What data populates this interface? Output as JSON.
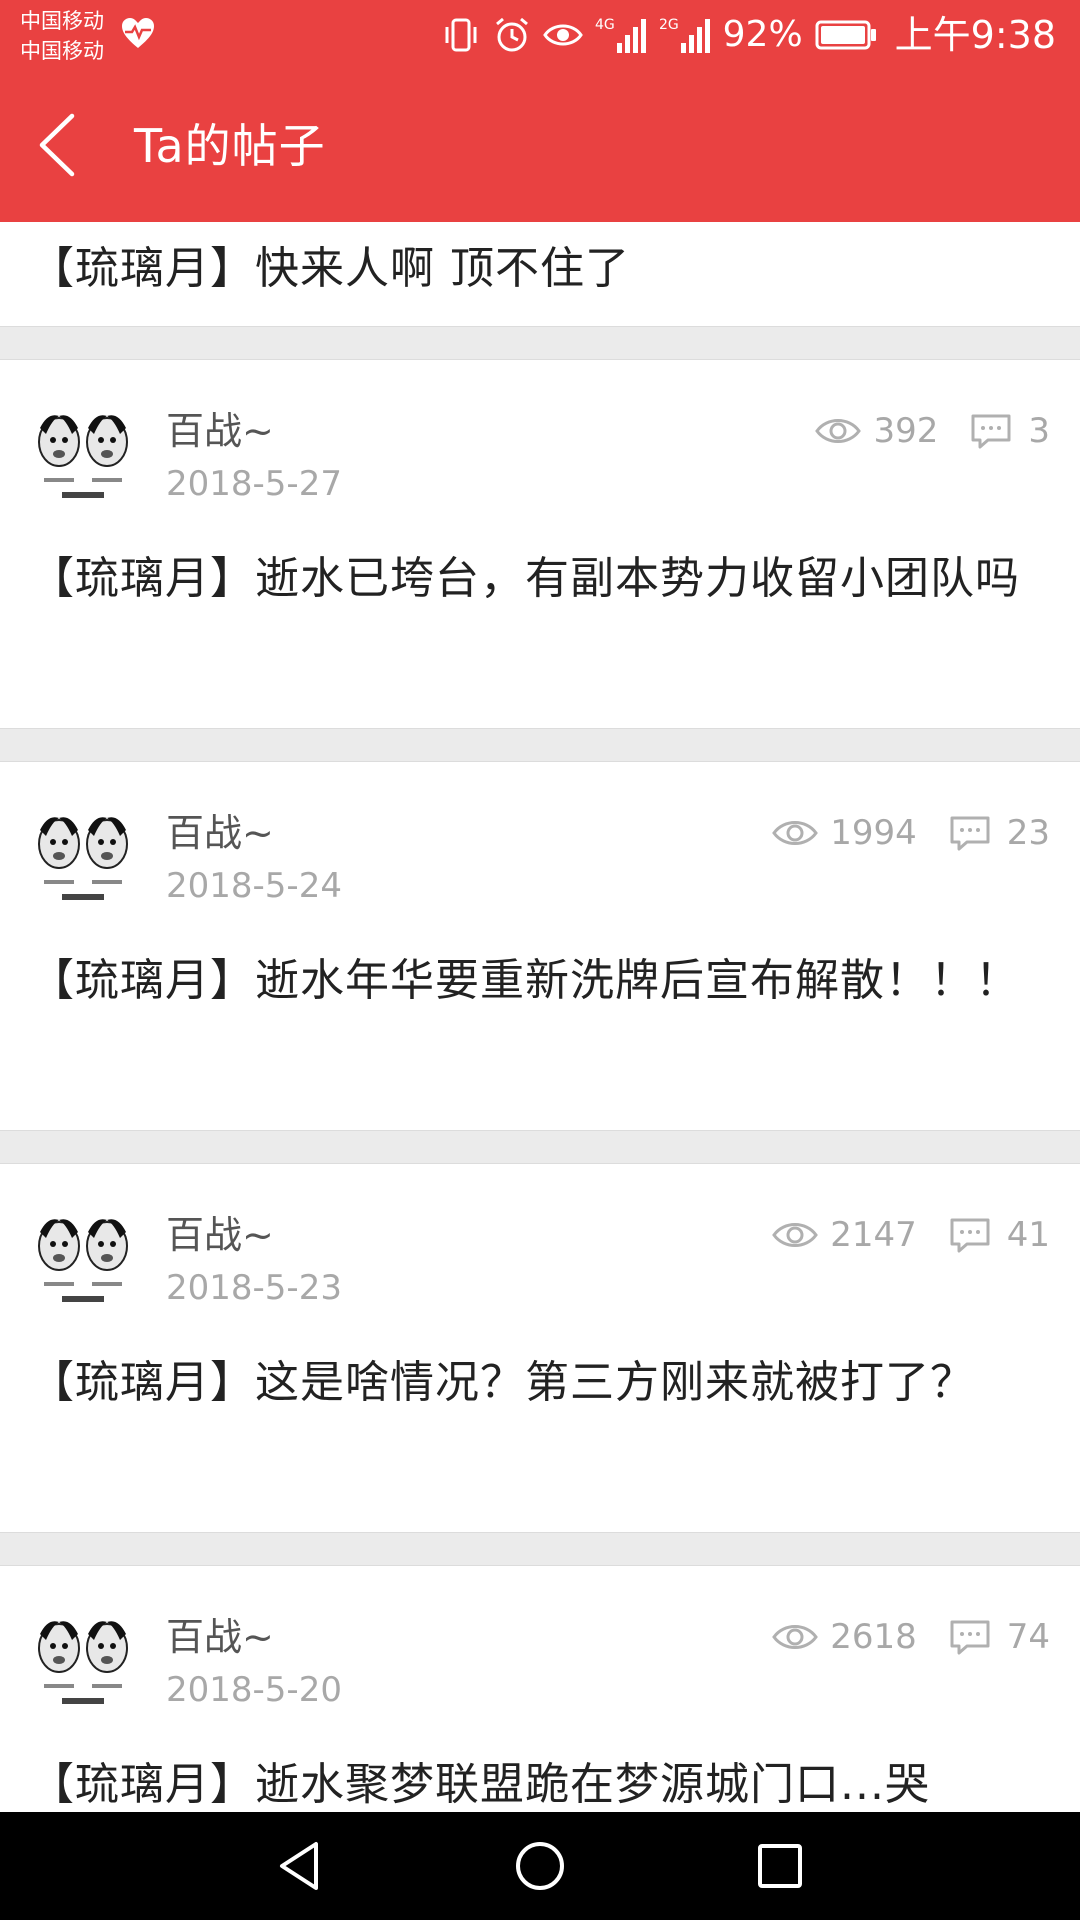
{
  "status_bar": {
    "carrier_1": "中国移动",
    "carrier_2": "中国移动",
    "network_1": "4G",
    "network_2": "2G",
    "battery": "92%",
    "time": "上午9:38",
    "icons": [
      "heart-pulse-icon",
      "vibrate-icon",
      "alarm-icon",
      "eye-icon",
      "signal-4g-icon",
      "signal-2g-icon",
      "battery-icon"
    ]
  },
  "app_bar": {
    "back_icon": "chevron-left-icon",
    "title": "Ta的帖子",
    "background_color": "#e94141"
  },
  "partial_post": {
    "title": "【琉璃月】快来人啊 顶不住了"
  },
  "posts": [
    {
      "author": "百战~",
      "date": "2018-5-27",
      "views": "392",
      "comments": "3",
      "title": "【琉璃月】逝水已垮台，有副本势力收留小团队吗"
    },
    {
      "author": "百战~",
      "date": "2018-5-24",
      "views": "1994",
      "comments": "23",
      "title": "【琉璃月】逝水年华要重新洗牌后宣布解散！！！"
    },
    {
      "author": "百战~",
      "date": "2018-5-23",
      "views": "2147",
      "comments": "41",
      "title": "【琉璃月】这是啥情况？第三方刚来就被打了？"
    },
    {
      "author": "百战~",
      "date": "2018-5-20",
      "views": "2618",
      "comments": "74",
      "title": "【琉璃月】逝水聚梦联盟跪在梦源城门口...哭"
    }
  ],
  "nav_bar": {
    "icons": [
      "nav-back-icon",
      "nav-home-icon",
      "nav-recent-icon"
    ]
  }
}
